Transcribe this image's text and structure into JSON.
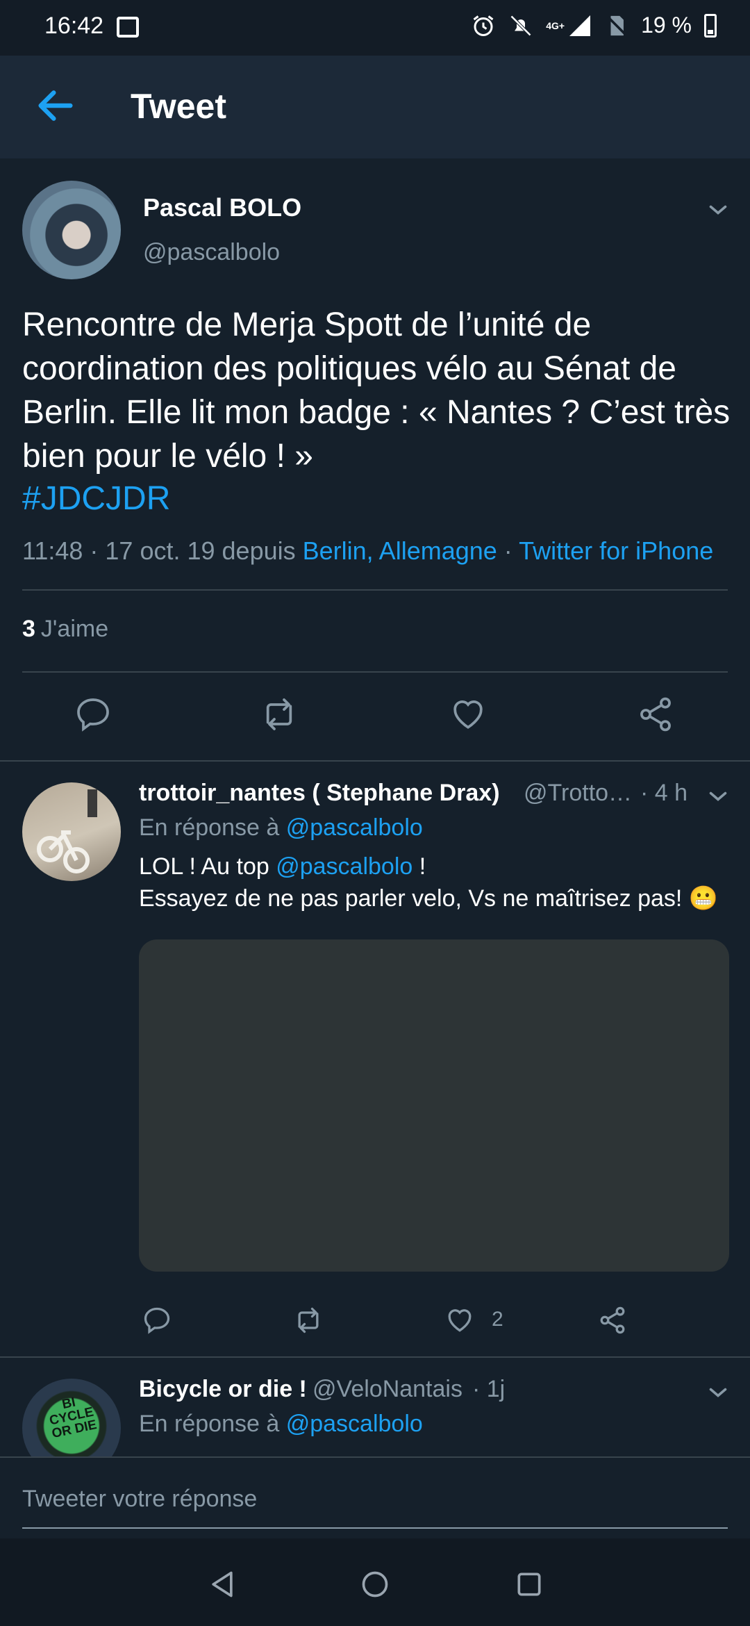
{
  "status_bar": {
    "time": "16:42",
    "network": "4G+",
    "battery": "19 %",
    "icons": [
      "image-icon",
      "alarm-icon",
      "bell-off-icon",
      "signal-icon",
      "no-sim-icon",
      "battery-icon"
    ]
  },
  "header": {
    "title": "Tweet",
    "back_icon": "arrow-left-icon"
  },
  "main_tweet": {
    "name": "Pascal BOLO",
    "handle": "@pascalbolo",
    "text": "Rencontre de Merja Spott de l’unité de coordination des politiques vélo au Sénat de Berlin. Elle lit mon badge : « Nantes ? C’est très bien pour le vélo ! »",
    "hashtag": "#JDCJDR",
    "time": "11:48 · 17 oct. 19 depuis ",
    "location": "Berlin, Allemagne",
    "separator": " · ",
    "client": "Twitter for iPhone",
    "likes_count": "3",
    "likes_label": "J'aime"
  },
  "replies": [
    {
      "name": "trottoir_nantes ( Stephane Drax)",
      "handle": "@Trotto…",
      "time": "· 4 h",
      "reply_prefix": "En réponse à ",
      "reply_to": "@pascalbolo",
      "text_part1": "LOL ! Au top ",
      "mention": "@pascalbolo",
      "text_part2": " !",
      "text_line2": "Essayez de ne pas parler velo, Vs ne maîtrisez pas! 😬",
      "like_count": "2"
    },
    {
      "name": "Bicycle or die !",
      "handle": "@VeloNantais",
      "time": "· 1j",
      "reply_prefix": "En réponse à ",
      "reply_to": "@pascalbolo",
      "avatar_text": "BI CYCLE OR DIE"
    }
  ],
  "composer": {
    "placeholder": "Tweeter votre réponse"
  },
  "colors": {
    "background": "#15202b",
    "header": "#1c2938",
    "accent": "#1da1f2",
    "muted": "#8899a6",
    "divider": "#38444d"
  }
}
